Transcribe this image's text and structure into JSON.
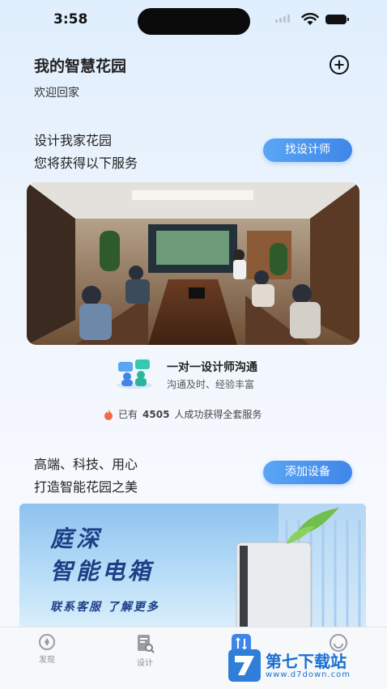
{
  "status_bar": {
    "time": "3:58"
  },
  "header": {
    "title": "我的智慧花园",
    "subtitle": "欢迎回家"
  },
  "design_section": {
    "line1": "设计我家花园",
    "line2": "您将获得以下服务",
    "button_label": "找设计师",
    "image_alt": "Meeting room with designers",
    "service_title": "一对一设计师沟通",
    "service_subtitle": "沟通及时、经验丰富",
    "stat_prefix": "已有",
    "stat_count": "4505",
    "stat_suffix": "人成功获得全套服务"
  },
  "device_section": {
    "line1": "高端、科技、用心",
    "line2": "打造智能花园之美",
    "button_label": "添加设备",
    "banner_line1": "庭深",
    "banner_line2": "智能电箱",
    "banner_line3": "联系客服 了解更多"
  },
  "tabbar": {
    "items": [
      {
        "label": "发现",
        "icon": "compass-icon"
      },
      {
        "label": "设计",
        "icon": "document-search-icon"
      },
      {
        "label": "",
        "icon": "sort-arrows-icon",
        "active": true
      },
      {
        "label": "",
        "icon": "smile-face-icon"
      }
    ]
  },
  "watermark": {
    "text": "第七下载站",
    "url": "www.d7down.com"
  },
  "colors": {
    "accent": "#3f86e8",
    "banner_text": "#1c3f86",
    "flame": "#f06a4a"
  }
}
